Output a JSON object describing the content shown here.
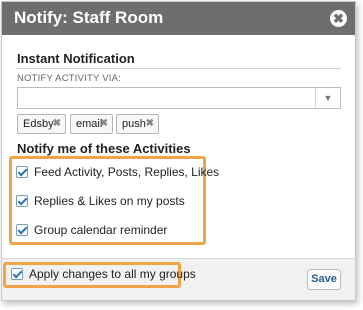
{
  "dialog": {
    "title": "Notify: Staff Room",
    "close_icon": "✖"
  },
  "instant": {
    "heading": "Instant Notification",
    "field_label": "NOTIFY ACTIVITY VIA:",
    "select_value": "",
    "chips": [
      {
        "label": "Edsby",
        "remove_icon": "✖"
      },
      {
        "label": "email",
        "remove_icon": "✖"
      },
      {
        "label": "push",
        "remove_icon": "✖"
      }
    ]
  },
  "activities": {
    "heading": "Notify me of these Activities",
    "items": [
      {
        "label": "Feed Activity, Posts, Replies, Likes",
        "checked": true
      },
      {
        "label": "Replies & Likes on my posts",
        "checked": true
      },
      {
        "label": "Group calendar reminder",
        "checked": true
      }
    ]
  },
  "footer": {
    "apply_label": "Apply changes to all my groups",
    "apply_checked": true,
    "save_label": "Save"
  },
  "colors": {
    "titlebar": "#6e6e6e",
    "highlight": "#f0a347",
    "accent": "#2a73b8"
  },
  "icons": {
    "close": "close-icon",
    "dropdown": "chevron-down-icon",
    "chip_remove": "remove-icon",
    "check": "checkmark-icon"
  }
}
